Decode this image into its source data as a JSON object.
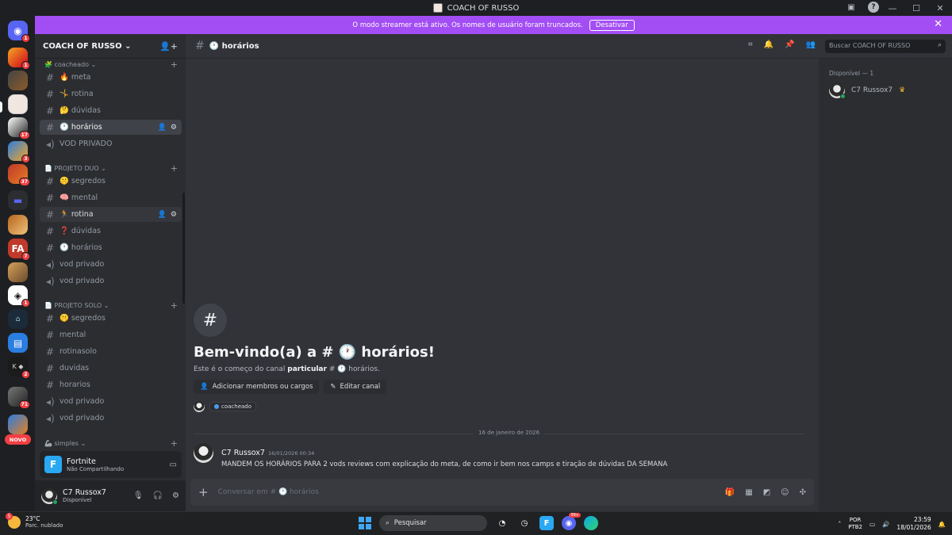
{
  "window": {
    "title": "COACH OF RUSSO",
    "controls": [
      "—",
      "☐",
      "✕"
    ]
  },
  "banner": {
    "text": "O modo streamer está ativo. Os nomes de usuário foram truncados.",
    "button": "Desativar",
    "close": "✕"
  },
  "rail": {
    "badges": {
      "home": "1",
      "s1": "1",
      "s5": "17",
      "s6": "3",
      "s7": "37",
      "s10": "7",
      "s12": "1",
      "s15": "2",
      "s16": "71"
    },
    "novo": "NOVO"
  },
  "server": {
    "name": "COACH OF RUSSO ⌄"
  },
  "categories": [
    {
      "label": "🧩 coacheado ⌄"
    },
    {
      "label": "📄 PROJETO DUO ⌄"
    },
    {
      "label": "📄 PROJETO SOLO ⌄"
    },
    {
      "label": "🦾 simples ⌄"
    }
  ],
  "channels": [
    {
      "label": "🔥 meta"
    },
    {
      "label": "🤸 rotina"
    },
    {
      "label": "🤔 dúvidas"
    },
    {
      "label": "🕐 horários"
    },
    {
      "label": "VOD PRIVADO"
    },
    {
      "label": "🤫 segredos"
    },
    {
      "label": "🧠 mental"
    },
    {
      "label": "🏃 rotina"
    },
    {
      "label": "❓ dúvidas"
    },
    {
      "label": "🕐 horários"
    },
    {
      "label": "vod privado"
    },
    {
      "label": "vod privado"
    },
    {
      "label": "🤫 segredos"
    },
    {
      "label": "mental"
    },
    {
      "label": "rotinasolo"
    },
    {
      "label": "duvidas"
    },
    {
      "label": "horarios"
    },
    {
      "label": "vod privado"
    },
    {
      "label": "vod privado"
    }
  ],
  "activity": {
    "game": "Fortnite",
    "status": "Não Compartilhando",
    "icon_letter": "F"
  },
  "user": {
    "name": "C7 Russox7",
    "status": "Disponível"
  },
  "channel_header": {
    "name": "🕐 horários"
  },
  "search": {
    "placeholder": "Buscar COACH OF RUSSO"
  },
  "welcome": {
    "title": "Bem-vindo(a) a # 🕐 horários!",
    "sub_prefix": "Este é o começo do canal ",
    "sub_bold": "particular",
    "sub_suffix": " # 🕐 horários.",
    "add_members": "Adicionar membros ou cargos",
    "edit_channel": "Editar canal",
    "role": "coacheado"
  },
  "divider_date": "16 de janeiro de 2026",
  "message": {
    "author": "C7 Russox7",
    "time": "16/01/2026 00:34",
    "text": "MANDEM OS HORÁRIOS PARA 2 vods reviews com explicação do meta, de como ir bem nos camps e tiração de dúvidas DA SEMANA"
  },
  "composer": {
    "placeholder": "Conversar em # 🕐 horários"
  },
  "members": {
    "group": "Disponível — 1",
    "list": [
      {
        "name": "C7 Russox7"
      }
    ]
  },
  "taskbar": {
    "temp": "23°C",
    "weather": "Parc. nublado",
    "weather_badge": "5",
    "search": "Pesquisar",
    "discord_badge": "99+",
    "lang1": "POR",
    "lang2": "PTB2",
    "time": "23:59",
    "date": "18/01/2026"
  },
  "colors": {
    "accent": "#a34ef4",
    "badge": "#f23f43",
    "online": "#23a55a"
  }
}
